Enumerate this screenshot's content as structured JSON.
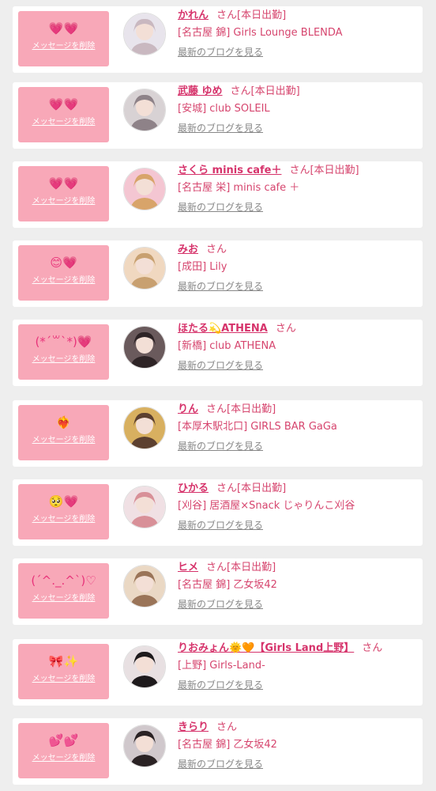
{
  "common": {
    "delete_label": "メッセージを削除",
    "blog_label": "最新のブログを見る",
    "san": "さん"
  },
  "colors": {
    "accent": "#d6336b",
    "message_box": "#f8a8b8",
    "background": "#eeeeee"
  },
  "entries": [
    {
      "emoji": "💗💗",
      "name": "かれん",
      "status": "[本日出勤]",
      "shop": "[名古屋 錦] Girls Lounge BLENDA",
      "avatar_colors": [
        "#e8e4ec",
        "#c9b8c0"
      ]
    },
    {
      "emoji": "💗💗",
      "name": "武藤 ゆめ",
      "status": "[本日出勤]",
      "shop": "[安城] club SOLEIL",
      "avatar_colors": [
        "#d8d2d4",
        "#8e8288"
      ]
    },
    {
      "emoji": "💗💗",
      "name": "さくら minis cafe＋",
      "status": "[本日出勤]",
      "shop": "[名古屋 栄] minis cafe ＋",
      "avatar_colors": [
        "#f4c6d2",
        "#d8a46a"
      ]
    },
    {
      "emoji": "😊💗",
      "name": "みお",
      "status": "",
      "shop": "[成田] Lily",
      "avatar_colors": [
        "#f0d8c0",
        "#c8a070"
      ]
    },
    {
      "emoji": "(*´꒳`*)💗",
      "name": "ほたる💫ATHENA",
      "status": "",
      "shop": "[新橋] club ATHENA",
      "avatar_colors": [
        "#6a5a5c",
        "#2e2426"
      ]
    },
    {
      "emoji": "❤️‍🔥",
      "name": "りん",
      "status": "[本日出勤]",
      "shop": "[本厚木駅北口] GIRLS BAR GaGa",
      "avatar_colors": [
        "#d8b060",
        "#5c4030"
      ]
    },
    {
      "emoji": "🥺💗",
      "name": "ひかる",
      "status": "[本日出勤]",
      "shop": "[刈谷] 居酒屋×Snack じゃりんこ刈谷",
      "avatar_colors": [
        "#f0e0e4",
        "#d89098"
      ]
    },
    {
      "emoji": "(ˊ^._.^ˋ)♡",
      "name": "ヒメ",
      "status": "[本日出勤]",
      "shop": "[名古屋 錦] 乙女坂42",
      "avatar_colors": [
        "#ead8c4",
        "#9a7458"
      ]
    },
    {
      "emoji": "🎀✨",
      "name": "りおみょん🌞🧡【Girls Land上野】",
      "status": "",
      "shop": "[上野] Girls-Land-",
      "avatar_colors": [
        "#e8e0e2",
        "#1e1a1c"
      ]
    },
    {
      "emoji": "💕💕",
      "name": "きらり",
      "status": "",
      "shop": "[名古屋 錦] 乙女坂42",
      "avatar_colors": [
        "#d0c8cc",
        "#2a2224"
      ]
    }
  ]
}
